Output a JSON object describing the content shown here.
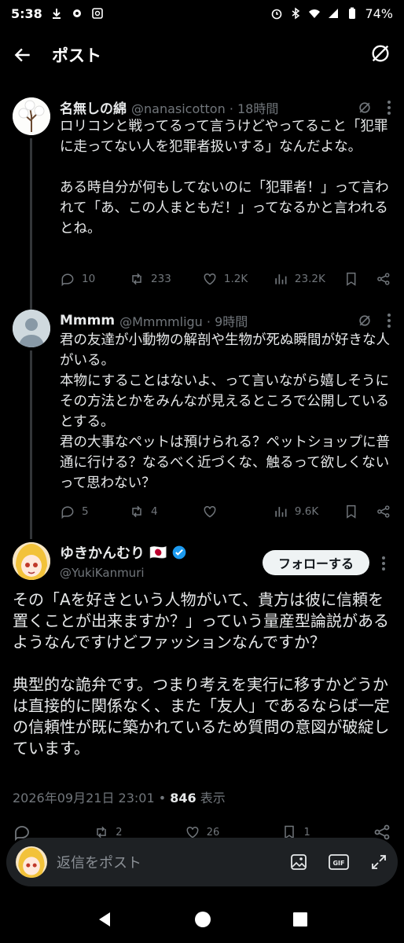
{
  "status_bar": {
    "time": "5:38",
    "battery": "74%"
  },
  "header": {
    "title": "ポスト"
  },
  "thread": [
    {
      "name": "名無しの綿",
      "handle": "@nanasicotton · 18時間",
      "text": "ロリコンと戦ってるって言うけどやってること「犯罪に走ってない人を犯罪者扱いする」なんだよな。\n\nある時自分が何もしてないのに「犯罪者！」って言われて「あ、この人まともだ！」ってなるかと言われるとね。",
      "replies": "10",
      "reposts": "233",
      "likes": "1.2K",
      "views": "23.2K"
    },
    {
      "name": "Mmmm",
      "handle": "@Mmmmligu · 9時間",
      "text": "君の友達が小動物の解剖や生物が死ぬ瞬間が好きな人がいる。\n本物にすることはないよ、って言いながら嬉しそうにその方法とかをみんなが見えるところで公開しているとする。\n君の大事なペットは預けられる？ペットショップに普通に行ける？なるべく近づくな、触るって欲しくないって思わない？",
      "replies": "5",
      "reposts": "4",
      "views": "9.6K"
    }
  ],
  "main_post": {
    "name": "ゆきかんむり",
    "flag": "🇯🇵",
    "handle": "@YukiKanmuri",
    "follow_label": "フォローする",
    "text": "その「Aを好きという人物がいて、貴方は彼に信頼を置くことが出来ますか？」っていう量産型論説があるようなんですけどファッションなんですか？\n\n典型的な詭弁です。つまり考えを実行に移すかどうかは直接的に関係なく、また「友人」であるならば一定の信頼性が既に築かれているため質問の意図が破綻しています。",
    "timestamp": "2026年09月21日 23:01",
    "separator": " • ",
    "views_count": "846",
    "views_label": " 表示",
    "reposts": "2",
    "likes": "26",
    "bookmarks": "1"
  },
  "reply_bar": {
    "placeholder": "返信をポスト"
  },
  "colors": {
    "background": "#000000",
    "muted": "#71767b",
    "verified": "#1d9bf0"
  }
}
